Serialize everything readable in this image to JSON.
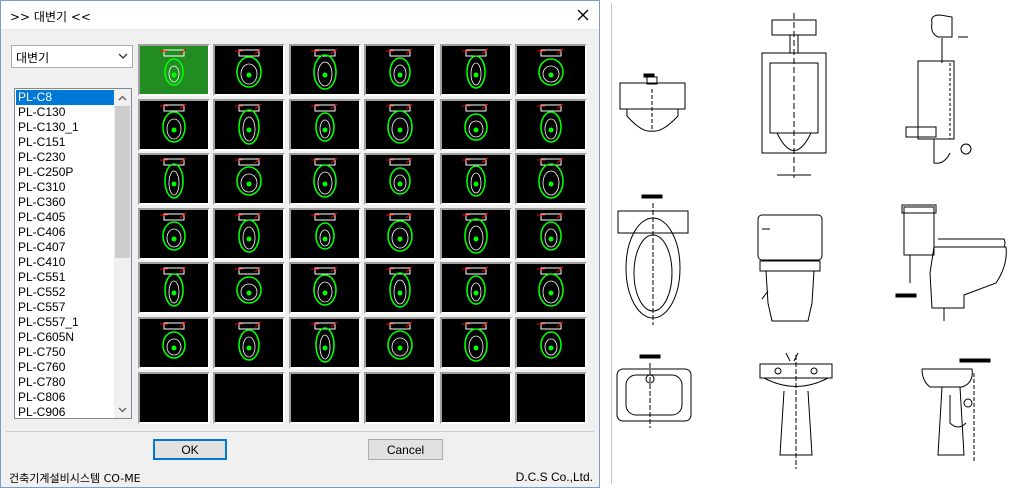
{
  "dialog": {
    "title": ">> 대변기 <<",
    "close_icon": "close-icon",
    "category_select": {
      "value": "대변기"
    },
    "list": {
      "selected_index": 0,
      "items": [
        "PL-C8",
        "PL-C130",
        "PL-C130_1",
        "PL-C151",
        "PL-C230",
        "PL-C250P",
        "PL-C310",
        "PL-C360",
        "PL-C405",
        "PL-C406",
        "PL-C407",
        "PL-C410",
        "PL-C551",
        "PL-C552",
        "PL-C557",
        "PL-C557_1",
        "PL-C605N",
        "PL-C750",
        "PL-C760",
        "PL-C780",
        "PL-C806",
        "PL-C906"
      ]
    },
    "thumbnails": {
      "rows": 7,
      "cols": 6,
      "filled_count": 36,
      "selected_index": 0,
      "colors": {
        "tile_bg": "#000000",
        "selected_bg": "#228b22",
        "fixture_stroke": "#00ff00",
        "detail_stroke": "#ffffff",
        "accent": "#ff0000"
      }
    },
    "buttons": {
      "ok": "OK",
      "cancel": "Cancel"
    },
    "status": {
      "left": "건축기계설비시스템   CO-ME",
      "right": "D.C.S Co.,Ltd."
    }
  },
  "preview": {
    "fixtures": [
      "wall-sink-front",
      "urinal-front",
      "urinal-side",
      "toilet-top",
      "toilet-front",
      "toilet-side",
      "basin-top",
      "pedestal-basin-front",
      "pedestal-basin-side"
    ]
  }
}
